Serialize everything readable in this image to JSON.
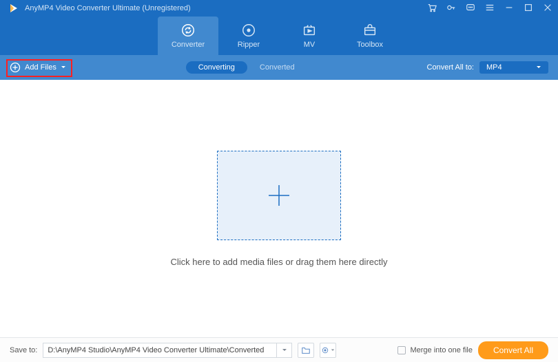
{
  "app": {
    "title": "AnyMP4 Video Converter Ultimate (Unregistered)"
  },
  "nav": {
    "converter": "Converter",
    "ripper": "Ripper",
    "mv": "MV",
    "toolbox": "Toolbox"
  },
  "toolbar": {
    "add_files": "Add Files",
    "tab_converting": "Converting",
    "tab_converted": "Converted",
    "convert_all_to": "Convert All to:",
    "format": "MP4"
  },
  "main": {
    "drop_text": "Click here to add media files or drag them here directly"
  },
  "footer": {
    "save_to_label": "Save to:",
    "save_path": "D:\\AnyMP4 Studio\\AnyMP4 Video Converter Ultimate\\Converted",
    "merge_label": "Merge into one file",
    "convert_all": "Convert All"
  }
}
